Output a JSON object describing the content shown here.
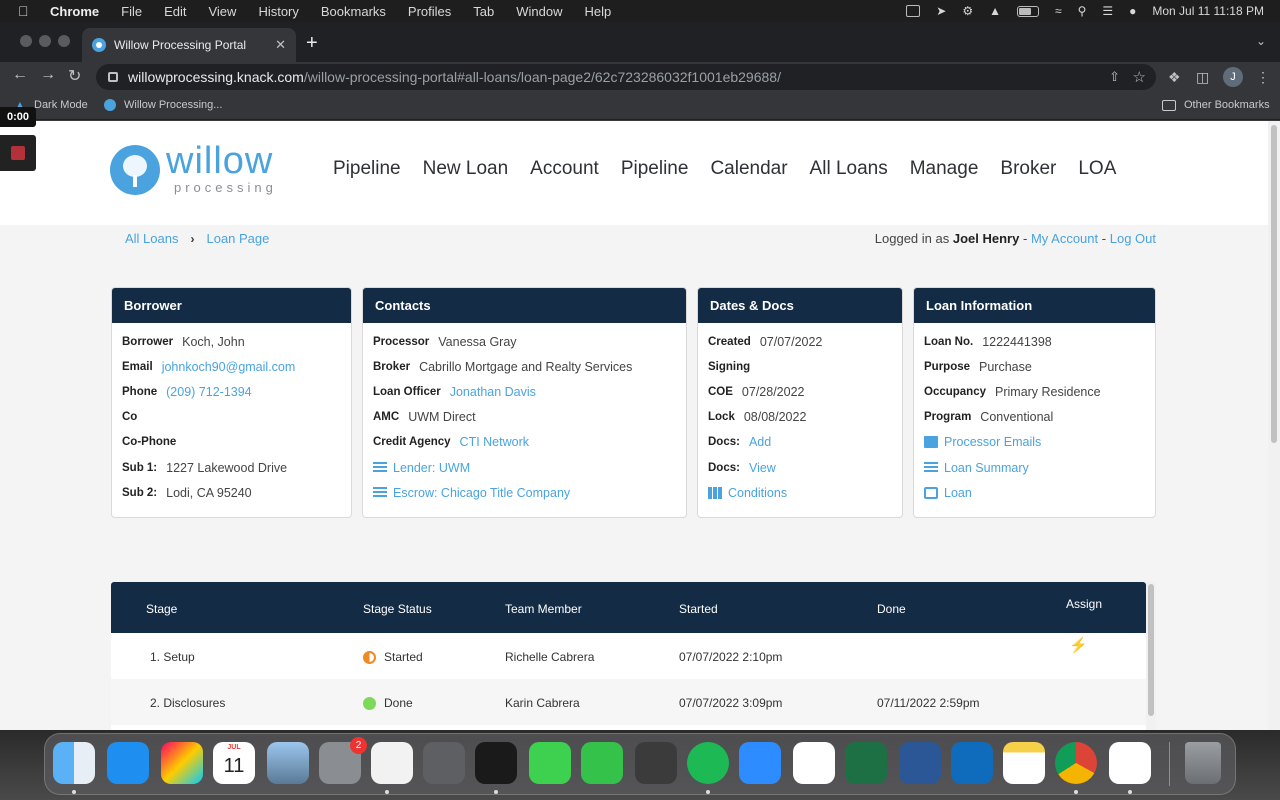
{
  "menubar": {
    "app": "Chrome",
    "menus": [
      "File",
      "Edit",
      "View",
      "History",
      "Bookmarks",
      "Profiles",
      "Tab",
      "Window",
      "Help"
    ],
    "clock": "Mon Jul 11  11:18 PM"
  },
  "browser": {
    "tab_title": "Willow Processing Portal",
    "url_host": "willowprocessing.knack.com",
    "url_path": "/willow-processing-portal#all-loans/loan-page2/62c723286032f1001eb29688/",
    "profile_initial": "J",
    "bookmarks": [
      "Dark Mode",
      "Willow Processing..."
    ],
    "other_bookmarks": "Other Bookmarks"
  },
  "recorder": {
    "time": "0:00"
  },
  "site": {
    "logo_word": "willow",
    "logo_sub": "processing",
    "nav": [
      "Pipeline",
      "New Loan",
      "Account",
      "Pipeline",
      "Calendar",
      "All Loans",
      "Manage",
      "Broker",
      "LOA"
    ]
  },
  "breadcrumb": {
    "root": "All Loans",
    "current": "Loan Page"
  },
  "login": {
    "prefix": "Logged in as",
    "user": "Joel Henry",
    "sep": "-",
    "my_account": "My Account",
    "logout": "Log Out"
  },
  "borrower": {
    "title": "Borrower",
    "rows": [
      {
        "label": "Borrower",
        "value": "Koch, John"
      },
      {
        "label": "Email",
        "value": "johnkoch90@gmail.com"
      },
      {
        "label": "Phone",
        "value": "(209) 712-1394"
      },
      {
        "label": "Co",
        "value": ""
      },
      {
        "label": "Co-Phone",
        "value": ""
      },
      {
        "label": "Sub 1:",
        "value": "1227 Lakewood Drive"
      },
      {
        "label": "Sub 2:",
        "value": "Lodi, CA 95240"
      }
    ]
  },
  "contacts": {
    "title": "Contacts",
    "rows": [
      {
        "label": "Processor",
        "value": "Vanessa Gray"
      },
      {
        "label": "Broker",
        "value": "Cabrillo Mortgage and Realty Services"
      },
      {
        "label": "Loan Officer",
        "value": "Jonathan Davis"
      },
      {
        "label": "AMC",
        "value": "UWM Direct"
      },
      {
        "label": "Credit Agency",
        "value": "CTI Network"
      }
    ],
    "links": [
      "Lender: UWM",
      "Escrow: Chicago Title Company"
    ]
  },
  "dates": {
    "title": "Dates & Docs",
    "rows": [
      {
        "label": "Created",
        "value": "07/07/2022"
      },
      {
        "label": "Signing",
        "value": ""
      },
      {
        "label": "COE",
        "value": "07/28/2022"
      },
      {
        "label": "Lock",
        "value": "08/08/2022"
      },
      {
        "label": "Docs:",
        "value": "Add"
      },
      {
        "label": "Docs:",
        "value": "View"
      }
    ],
    "conditions": "Conditions"
  },
  "loaninfo": {
    "title": "Loan Information",
    "rows": [
      {
        "label": "Loan No.",
        "value": "1222441398"
      },
      {
        "label": "Purpose",
        "value": "Purchase"
      },
      {
        "label": "Occupancy",
        "value": "Primary Residence"
      },
      {
        "label": "Program",
        "value": "Conventional"
      }
    ],
    "links": [
      "Processor Emails",
      "Loan Summary",
      "Loan"
    ]
  },
  "stages": {
    "headers": [
      "Stage",
      "Stage Status",
      "Team Member",
      "Started",
      "Done",
      "Assign"
    ],
    "rows": [
      {
        "stage": "1. Setup",
        "status": "Started",
        "member": "Richelle Cabrera",
        "started": "07/07/2022 2:10pm",
        "done": ""
      },
      {
        "stage": "2. Disclosures",
        "status": "Done",
        "member": "Karin Cabrera",
        "started": "07/07/2022 3:09pm",
        "done": "07/11/2022 2:59pm"
      }
    ]
  },
  "dock": {
    "calendar_month": "JUL",
    "calendar_day": "11",
    "settings_badge": "2",
    "apps": [
      "finder-icon",
      "app-store-icon",
      "launchpad-icon",
      "calendar-icon",
      "preview-icon",
      "system-preferences-icon",
      "textedit-icon",
      "calculator-icon",
      "acrobat-icon",
      "messages-icon",
      "facetime-icon",
      "sublime-icon",
      "spotify-icon",
      "zoom-icon",
      "powerpoint-icon",
      "excel-icon",
      "word-icon",
      "outlook-icon",
      "notes-icon",
      "chrome-icon",
      "slack-icon",
      "trash-icon"
    ]
  }
}
